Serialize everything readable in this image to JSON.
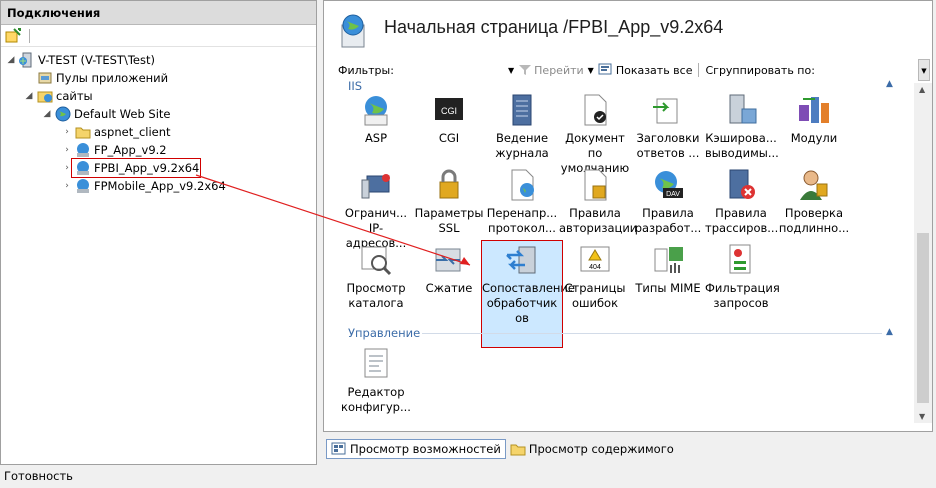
{
  "left": {
    "header": "Подключения",
    "tree": [
      {
        "label": "V-TEST (V-TEST\\Test)",
        "icon": "server-icon",
        "expander": "collapse"
      },
      {
        "label": "Пулы приложений",
        "icon": "app-pool-icon",
        "expander": ""
      },
      {
        "label": "сайты",
        "icon": "sites-folder-icon",
        "expander": "collapse"
      },
      {
        "label": "Default Web Site",
        "icon": "globe-icon",
        "expander": "collapse"
      },
      {
        "label": "aspnet_client",
        "icon": "folder-icon",
        "expander": "expand"
      },
      {
        "label": "FP_App_v9.2",
        "icon": "web-app-icon",
        "expander": "expand"
      },
      {
        "label": "FPBI_App_v9.2x64",
        "icon": "web-app-icon",
        "expander": "expand",
        "selected": true
      },
      {
        "label": "FPMobile_App_v9.2x64",
        "icon": "web-app-icon",
        "expander": "expand"
      }
    ]
  },
  "right": {
    "title": "Начальная страница /FPBI_App_v9.2x64",
    "filters_label": "Фильтры:",
    "go_label": "Перейти",
    "show_all_label": "Показать все",
    "group_by_label": "Сгруппировать по:",
    "group_iis": "IIS",
    "group_manage": "Управление",
    "features": [
      [
        "ASP"
      ],
      [
        "CGI"
      ],
      [
        "Ведение",
        "журнала"
      ],
      [
        "Документ по",
        "умолчанию"
      ],
      [
        "Заголовки",
        "ответов ..."
      ],
      [
        "Кэширова...",
        "выводимы..."
      ],
      [
        "Модули"
      ],
      [
        "Огранич...",
        "IP-адресов..."
      ],
      [
        "Параметры",
        "SSL"
      ],
      [
        "Перенапр...",
        "протокол..."
      ],
      [
        "Правила",
        "авторизации"
      ],
      [
        "Правила",
        "разработ..."
      ],
      [
        "Правила",
        "трассиров..."
      ],
      [
        "Проверка",
        "подлинно..."
      ],
      [
        "Просмотр",
        "каталога"
      ],
      [
        "Сжатие"
      ],
      [
        "Сопоставление",
        "обработчик",
        "ов"
      ],
      [
        "Страницы",
        "ошибок"
      ],
      [
        "Типы MIME"
      ],
      [
        "Фильтрация",
        "запросов"
      ]
    ],
    "manage_features": [
      [
        "Редактор",
        "конфигур..."
      ]
    ]
  },
  "tabs": {
    "features_view": "Просмотр возможностей",
    "content_view": "Просмотр содержимого"
  },
  "status": "Готовность",
  "colors": {
    "accent": "#3c6ca8",
    "highlight": "#d00000",
    "selection": "#cce8ff"
  }
}
